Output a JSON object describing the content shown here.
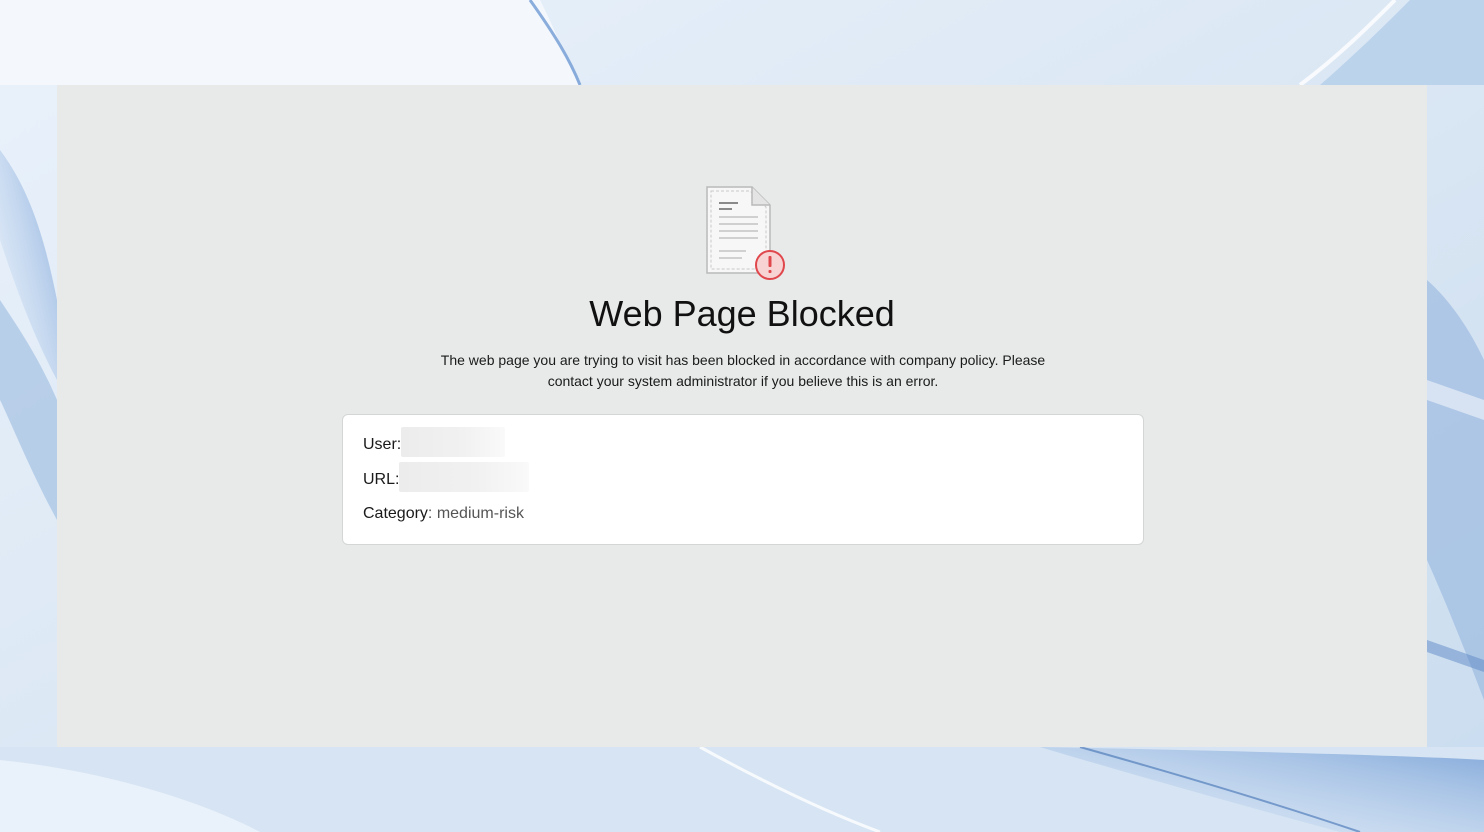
{
  "page": {
    "title": "Web Page Blocked",
    "description_line1": "The web page you are trying to visit has been blocked in accordance with company policy. Please",
    "description_line2": "contact your system administrator if you believe this is an error."
  },
  "info": {
    "user_label": "User:",
    "url_label": "URL:",
    "category_label": "Category",
    "category_separator": ":",
    "category_value": "medium-risk"
  },
  "icons": {
    "document": "document-icon",
    "alert": "exclamation-alert-icon"
  },
  "colors": {
    "panel_bg": "#e8eaea",
    "alert_red": "#e0474c",
    "alert_fill": "#f7d3d4"
  }
}
